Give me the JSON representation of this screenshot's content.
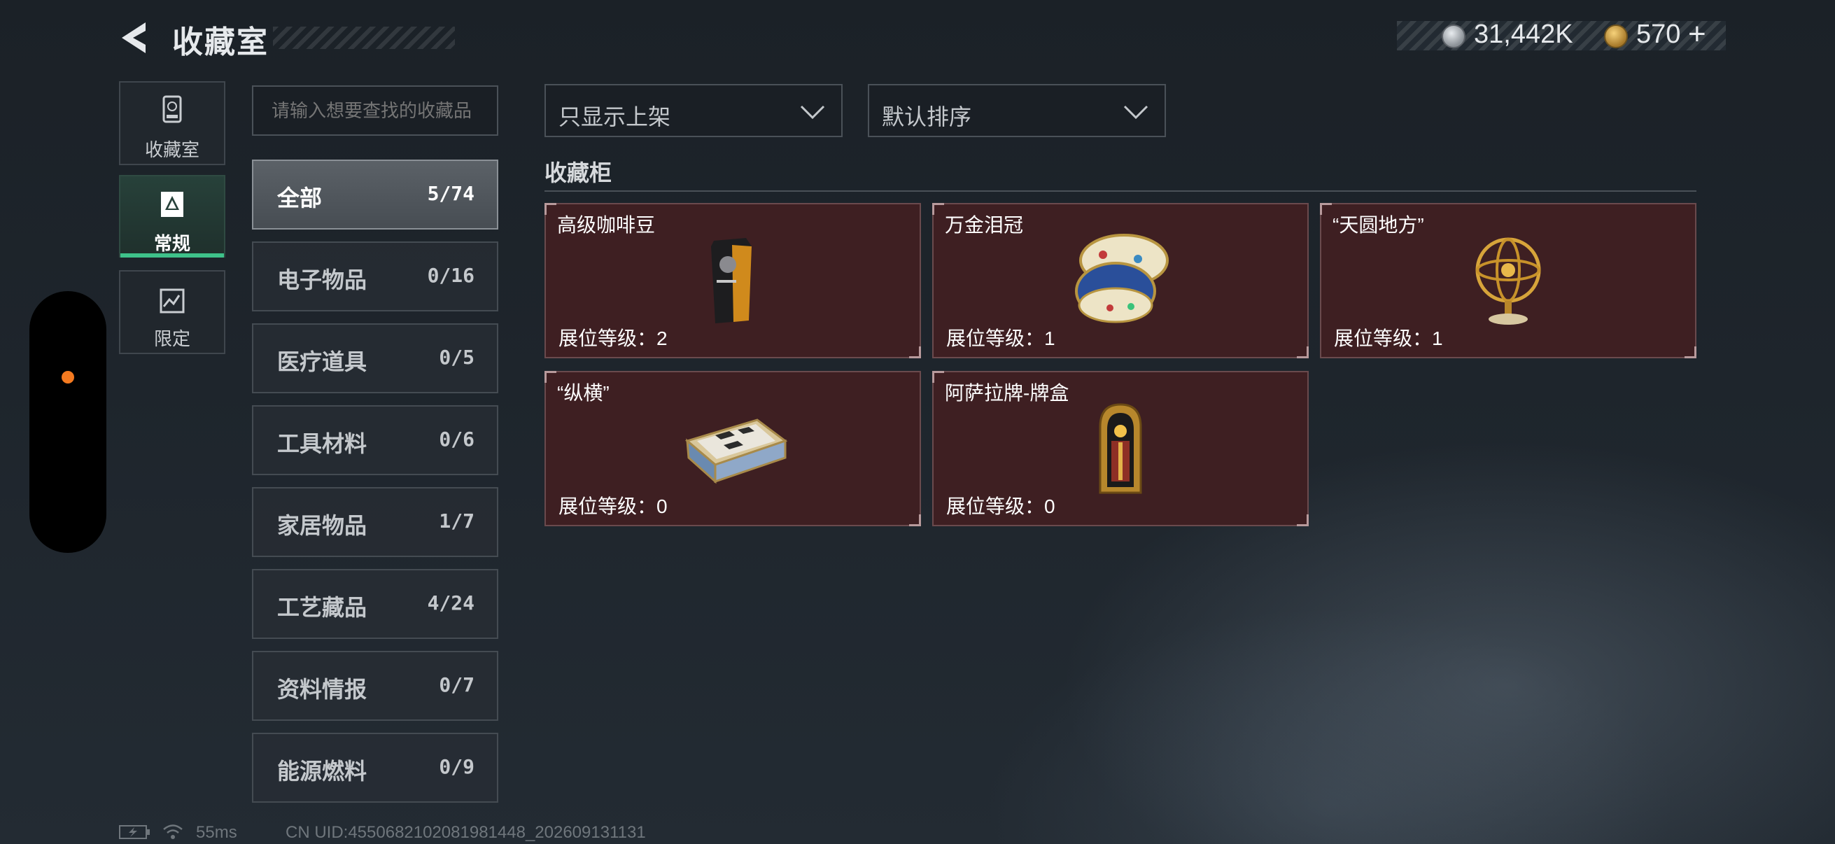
{
  "header": {
    "title": "收藏室",
    "currency_silver": "31,442K",
    "currency_gold": "570",
    "currency_gold_plus": "+"
  },
  "mini_nav": [
    {
      "label": "收藏室",
      "icon": "collection-room-icon",
      "active": false
    },
    {
      "label": "常规",
      "icon": "regular-icon",
      "active": true
    },
    {
      "label": "限定",
      "icon": "limited-icon",
      "active": false
    }
  ],
  "search": {
    "placeholder": "请输入想要查找的收藏品"
  },
  "categories": [
    {
      "name": "全部",
      "count": "5/74",
      "active": true
    },
    {
      "name": "电子物品",
      "count": "0/16"
    },
    {
      "name": "医疗道具",
      "count": "0/5"
    },
    {
      "name": "工具材料",
      "count": "0/6"
    },
    {
      "name": "家居物品",
      "count": "1/7"
    },
    {
      "name": "工艺藏品",
      "count": "4/24"
    },
    {
      "name": "资料情报",
      "count": "0/7"
    },
    {
      "name": "能源燃料",
      "count": "0/9"
    }
  ],
  "filters": {
    "display": "只显示上架",
    "sort": "默认排序"
  },
  "cabinet": {
    "title": "收藏柜",
    "items": [
      {
        "name": "高级咖啡豆",
        "level": "展位等级：2",
        "icon": "coffee-bean-bag-icon"
      },
      {
        "name": "万金泪冠",
        "level": "展位等级：1",
        "icon": "jeweled-egg-icon"
      },
      {
        "name": "“天圆地方”",
        "level": "展位等级：1",
        "icon": "armillary-sphere-icon"
      },
      {
        "name": "“纵横”",
        "level": "展位等级：0",
        "icon": "chess-box-icon"
      },
      {
        "name": "阿萨拉牌-牌盒",
        "level": "展位等级：0",
        "icon": "card-case-icon"
      }
    ]
  },
  "footer": {
    "ping": "55ms",
    "uid": "CN UID:4550682102081981448_202609131131"
  },
  "colors": {
    "card_bg": "#3e1f22",
    "active_accent": "#3ec28a",
    "handle_dot": "#f47a20"
  }
}
